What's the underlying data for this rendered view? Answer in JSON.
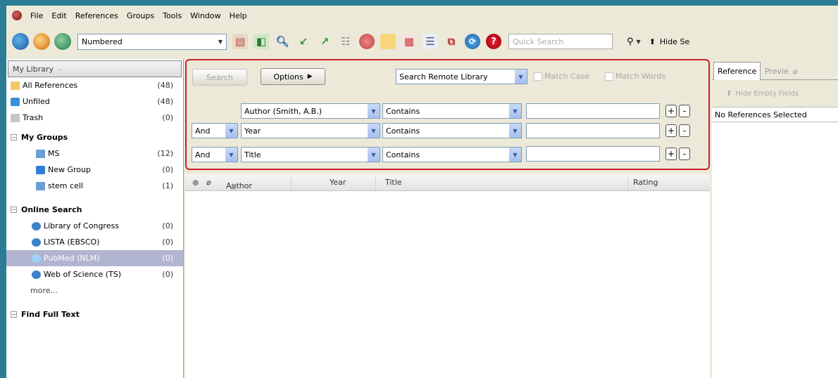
{
  "menu": [
    "File",
    "Edit",
    "References",
    "Groups",
    "Tools",
    "Window",
    "Help"
  ],
  "toolbar": {
    "output_style": "Numbered",
    "quick_search_placeholder": "Quick Search",
    "hide_label": "Hide Se"
  },
  "left": {
    "header": "My Library",
    "library_items": [
      {
        "label": "All References",
        "count": "(48)"
      },
      {
        "label": "Unfiled",
        "count": "(48)"
      },
      {
        "label": "Trash",
        "count": "(0)"
      }
    ],
    "my_groups": {
      "title": "My Groups",
      "items": [
        {
          "label": "MS",
          "count": "(12)"
        },
        {
          "label": "New Group",
          "count": "(0)"
        },
        {
          "label": "stem cell",
          "count": "(1)"
        }
      ]
    },
    "online_search": {
      "title": "Online Search",
      "items": [
        {
          "label": "Library of Congress",
          "count": "(0)"
        },
        {
          "label": "LISTA (EBSCO)",
          "count": "(0)"
        },
        {
          "label": "PubMed (NLM)",
          "count": "(0)"
        },
        {
          "label": "Web of Science (TS)",
          "count": "(0)"
        }
      ],
      "more": "more..."
    },
    "find_full_text": "Find Full Text"
  },
  "search": {
    "search_button": "Search",
    "options_button": "Options",
    "target": "Search Remote Library",
    "match_case": "Match Case",
    "match_words": "Match Words",
    "rows": [
      {
        "bool": "",
        "field": "Author (Smith, A.B.)",
        "operator": "Contains",
        "value": ""
      },
      {
        "bool": "And",
        "field": "Year",
        "operator": "Contains",
        "value": ""
      },
      {
        "bool": "And",
        "field": "Title",
        "operator": "Contains",
        "value": ""
      }
    ]
  },
  "ref_list": {
    "columns": [
      "Author",
      "Year",
      "Title",
      "Rating"
    ]
  },
  "right": {
    "tab_reference": "Reference",
    "tab_preview": "Previe",
    "hide_empty": "Hide Empty Fields",
    "no_refs": "No References Selected"
  }
}
